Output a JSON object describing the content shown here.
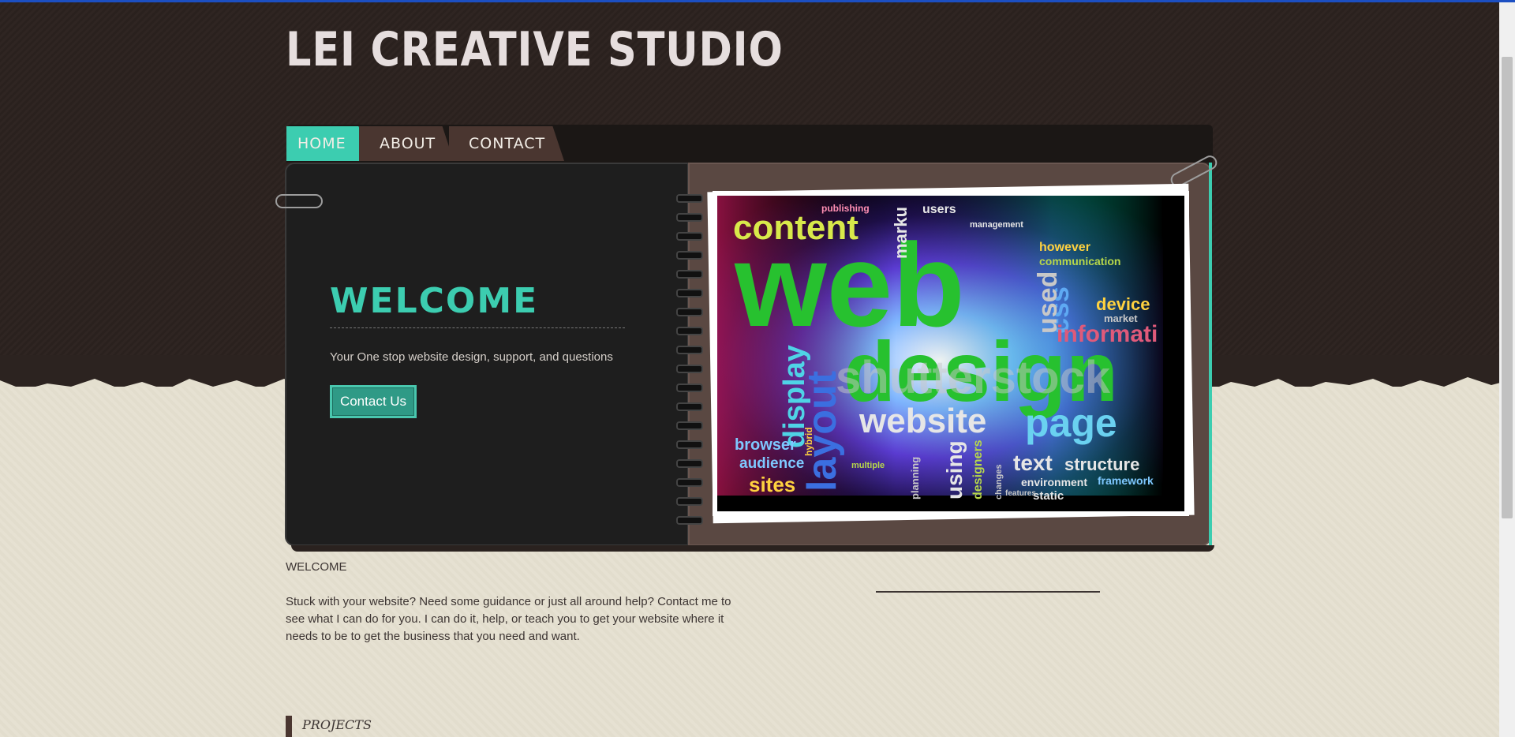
{
  "site": {
    "title": "LEI CREATIVE STUDIO"
  },
  "nav": {
    "tabs": [
      {
        "label": "HOME",
        "active": true
      },
      {
        "label": "ABOUT",
        "active": false
      },
      {
        "label": "CONTACT",
        "active": false
      }
    ]
  },
  "hero": {
    "heading": "WELCOME",
    "tagline": "Your One stop website design, support, and questions",
    "button_label": "Contact Us"
  },
  "content": {
    "welcome_label": "WELCOME",
    "body": "Stuck with your website? Need some guidance or just all around help? Contact me to see what I can do for you. I can do it, help, or teach you to get your website where it needs to be to get the business that you need and want.",
    "projects_label": "PROJECTS"
  },
  "image_words": {
    "big": [
      "web",
      "design"
    ],
    "medium": [
      "content",
      "website",
      "page",
      "display",
      "layout",
      "text",
      "structure",
      "css",
      "used",
      "informati",
      "browser",
      "audience",
      "sites",
      "using",
      "device",
      "however",
      "communication",
      "environment",
      "framework",
      "static"
    ],
    "small": [
      "publishing",
      "users",
      "management",
      "designers",
      "market",
      "hybrid",
      "multiple",
      "planning",
      "changes",
      "features",
      "marku"
    ],
    "watermark": "shutterstock"
  },
  "colors": {
    "accent": "#3ccdb0",
    "nav_bg": "#1b1715",
    "tab_inactive": "#4a3630",
    "header_bg": "#2d2320",
    "page_bg": "#e4dfcf",
    "top_line": "#1c4fc2"
  }
}
